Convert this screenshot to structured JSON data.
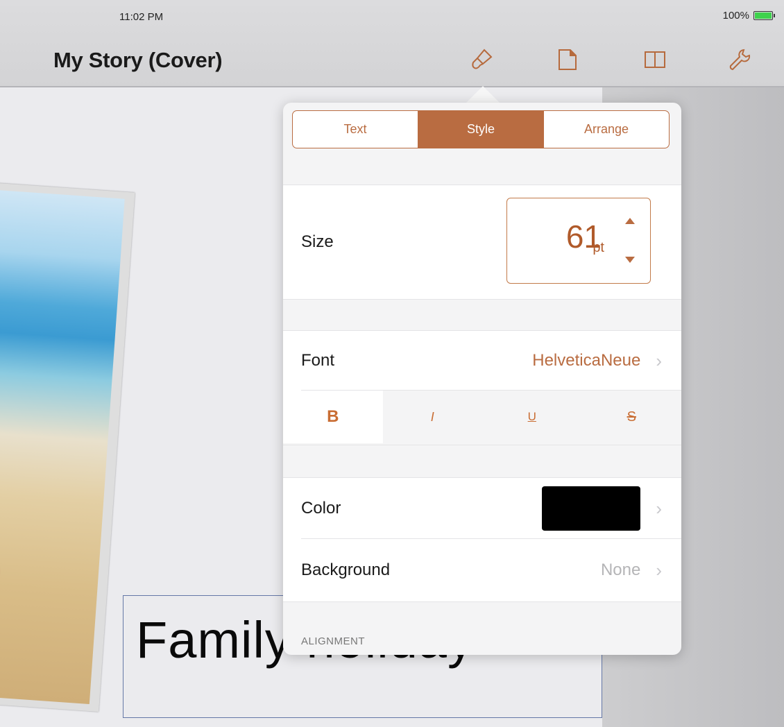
{
  "status": {
    "time": "11:02 PM",
    "battery": "100%"
  },
  "toolbar": {
    "title": "My Story (Cover)"
  },
  "canvas": {
    "text_box": "Family holiday"
  },
  "popover": {
    "tabs": [
      {
        "label": "Text",
        "active": false
      },
      {
        "label": "Style",
        "active": true
      },
      {
        "label": "Arrange",
        "active": false
      }
    ],
    "size": {
      "label": "Size",
      "value": "61",
      "unit": "pt"
    },
    "font": {
      "label": "Font",
      "value": "HelveticaNeue"
    },
    "text_styles": [
      {
        "label": "B",
        "selected": true
      },
      {
        "label": "I",
        "selected": false
      },
      {
        "label": "U",
        "selected": false
      },
      {
        "label": "S",
        "selected": false
      }
    ],
    "color": {
      "label": "Color",
      "swatch": "#000000"
    },
    "background": {
      "label": "Background",
      "value": "None"
    },
    "alignment_header": "ALIGNMENT"
  },
  "colors": {
    "accent": "#b96c41"
  }
}
